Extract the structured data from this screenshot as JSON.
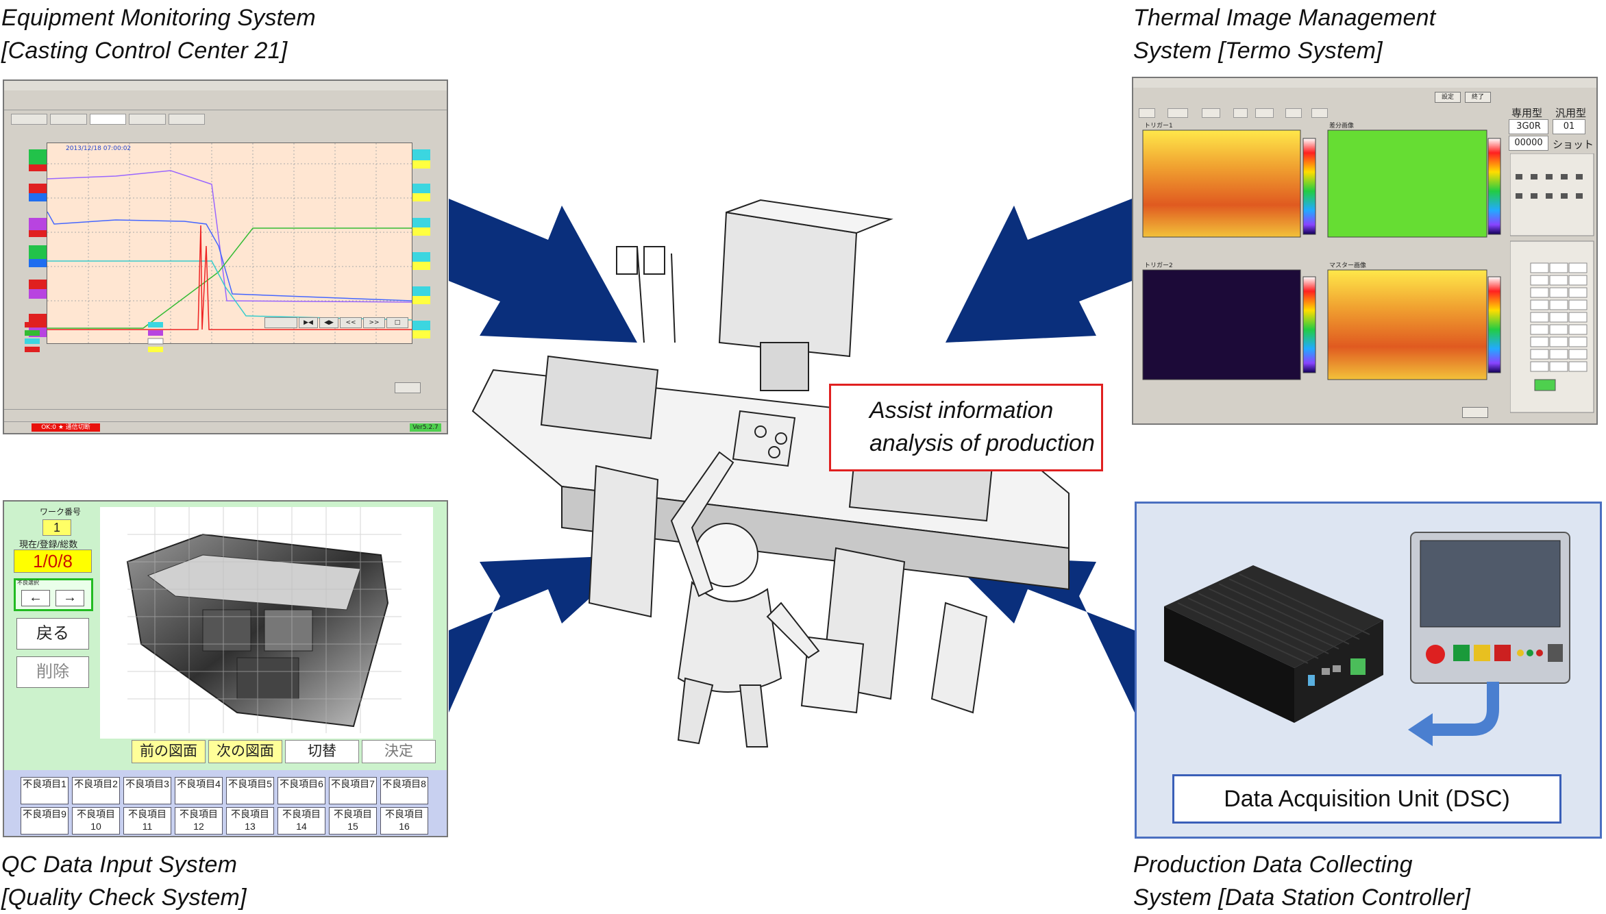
{
  "labels": {
    "equipment_line1": "Equipment Monitoring System",
    "equipment_line2": "[Casting Control Center 21]",
    "thermal_line1": "Thermal Image Management",
    "thermal_line2": "System [Termo System]",
    "qc_line1": "QC Data Input System",
    "qc_line2": "[Quality Check System]",
    "production_line1": "Production Data Collecting",
    "production_line2": "System [Data Station Controller]"
  },
  "callout": {
    "line1": "Assist information",
    "line2": "analysis of production"
  },
  "data_station": {
    "unit_label": "Data Acquisition Unit (DSC)"
  },
  "qc_screen": {
    "work_label": "ワーク番号",
    "work_number": "1",
    "count_label": "現在/登録/総数",
    "count_value": "1/0/8",
    "nav_group_label": "不良選択",
    "prev_arrow": "←",
    "next_arrow": "→",
    "back_button": "戻る",
    "delete_button": "削除",
    "prev_drawing": "前の図面",
    "next_drawing": "次の図面",
    "switch_button": "切替",
    "confirm_button": "決定",
    "defect_items": [
      "不良項目1",
      "不良項目2",
      "不良項目3",
      "不良項目4",
      "不良項目5",
      "不良項目6",
      "不良項目7",
      "不良項目8",
      "不良項目9",
      "不良項目10",
      "不良項目11",
      "不良項目12",
      "不良項目13",
      "不良項目14",
      "不良項目15",
      "不良項目16"
    ]
  },
  "thermal_screen": {
    "mold_type_label": "専用型",
    "general_type_label": "汎用型",
    "mold_code": "3G0R",
    "general_code": "01",
    "shot_count": "00000",
    "shot_label": "ショット数",
    "settings_button": "設定",
    "exit_button": "終了",
    "trigger1": "トリガー1",
    "trigger2": "トリガー2",
    "diff_image": "差分画像",
    "master_image": "マスター画像"
  },
  "em_screen": {
    "timestamp": "2013/12/18 07:00:02",
    "status_left": "OK:0 ★ 通信切断",
    "status_right": "Ver5.2.7"
  },
  "colors": {
    "arrow": "#0a2f7c",
    "callout_border": "#e02020",
    "dsc_border": "#3a5fb8"
  }
}
